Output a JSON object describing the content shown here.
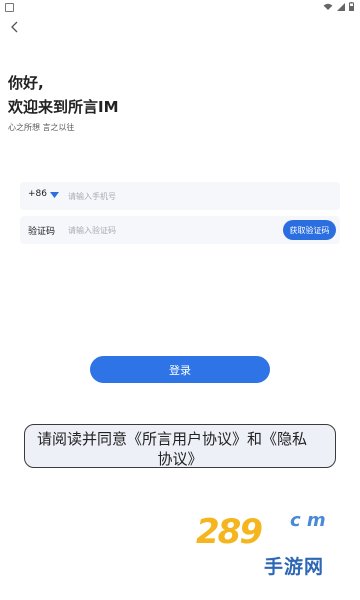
{
  "header": {
    "greeting": "你好,",
    "welcome": "欢迎来到所言IM",
    "slogan": "心之所想 言之以往"
  },
  "form": {
    "country_code": "+86",
    "phone_placeholder": "请输入手机号",
    "code_label": "验证码",
    "code_placeholder": "请输入验证码",
    "get_code_label": "获取验证码"
  },
  "login_label": "登录",
  "agreement": {
    "line1": "请阅读并同意《所言用户协议》和《隐私",
    "line2": "协议》"
  },
  "watermark": {
    "number": "289",
    "com": "c m",
    "cn": "手游网"
  },
  "colors": {
    "accent": "#2f74e6",
    "input_bg": "#f6f7fb"
  },
  "icons": [
    "back-arrow-icon",
    "caret-down-icon",
    "wifi-icon",
    "signal-icon",
    "battery-icon"
  ]
}
